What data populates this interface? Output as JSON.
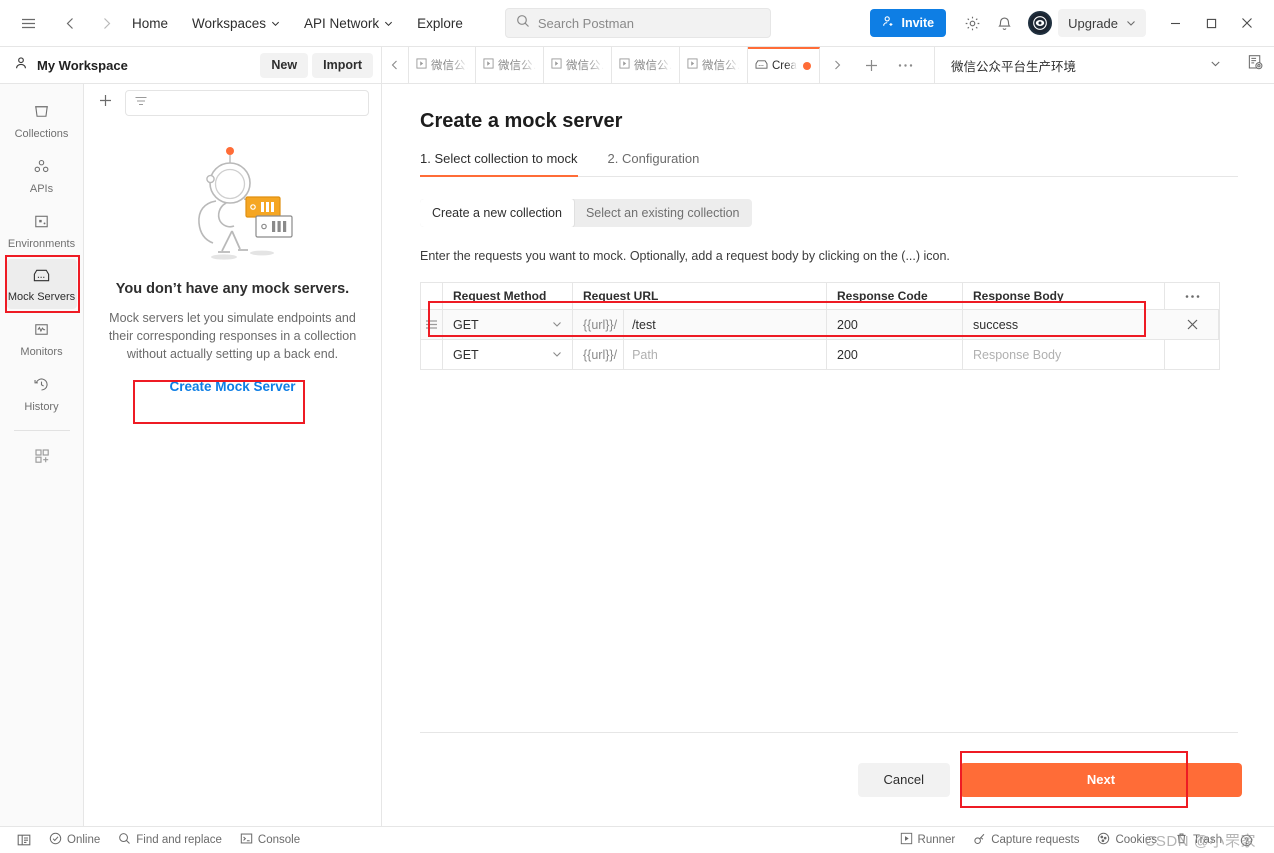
{
  "topbar": {
    "hamburger_icon": "menu-icon",
    "back_icon": "arrow-left-icon",
    "forward_icon": "arrow-right-icon",
    "links": [
      {
        "label": "Home",
        "caret": false
      },
      {
        "label": "Workspaces",
        "caret": true
      },
      {
        "label": "API Network",
        "caret": true
      },
      {
        "label": "Explore",
        "caret": false
      }
    ],
    "search_placeholder": "Search Postman",
    "search_value": "",
    "invite_label": "Invite",
    "settings_icon": "gear-icon",
    "notifications_icon": "bell-icon",
    "avatar_label": "avatar",
    "upgrade_label": "Upgrade",
    "minimize_label": "—",
    "maximize_label": "□",
    "close_label": "✕"
  },
  "workspace": {
    "name": "My Workspace",
    "new_label": "New",
    "import_label": "Import"
  },
  "tabbar": {
    "scroll_left_icon": "chevron-left-icon",
    "scroll_right_icon": "chevron-right-icon",
    "new_tab_icon": "plus-icon",
    "more_icon": "ellipsis-icon",
    "tabs": [
      {
        "label": "微信公…",
        "icon": "request-icon",
        "active": false,
        "unsaved": false
      },
      {
        "label": "微信公…",
        "icon": "request-icon",
        "active": false,
        "unsaved": false
      },
      {
        "label": "微信公…",
        "icon": "request-icon",
        "active": false,
        "unsaved": false
      },
      {
        "label": "微信公…",
        "icon": "request-icon",
        "active": false,
        "unsaved": false
      },
      {
        "label": "微信公…",
        "icon": "request-icon",
        "active": false,
        "unsaved": false
      },
      {
        "label": "Crea",
        "icon": "mock-server-icon",
        "active": true,
        "unsaved": true
      }
    ],
    "environment": "微信公众平台生产环境",
    "env_caret_icon": "chevron-down-icon",
    "env_view_icon": "eye-preview-icon"
  },
  "rail": {
    "items": [
      {
        "label": "Collections",
        "icon": "collections-icon",
        "active": false
      },
      {
        "label": "APIs",
        "icon": "apis-icon",
        "active": false
      },
      {
        "label": "Environments",
        "icon": "environments-icon",
        "active": false
      },
      {
        "label": "Mock Servers",
        "icon": "mock-servers-icon",
        "active": true
      },
      {
        "label": "Monitors",
        "icon": "monitors-icon",
        "active": false
      },
      {
        "label": "History",
        "icon": "history-icon",
        "active": false
      }
    ],
    "add_icon": "grid-plus-icon"
  },
  "sidebar": {
    "add_icon": "plus-icon",
    "filter_icon": "filter-icon",
    "filter_placeholder": "",
    "empty_title": "You don’t have any mock servers.",
    "empty_desc": "Mock servers let you simulate endpoints and their corresponding responses in a collection without actually setting up a back end.",
    "create_link": "Create Mock Server"
  },
  "main": {
    "title": "Create a mock server",
    "steps": [
      {
        "label": "1.  Select collection to mock",
        "active": true
      },
      {
        "label": "2. Configuration",
        "active": false
      }
    ],
    "segmented": [
      {
        "label": "Create a new collection",
        "active": true
      },
      {
        "label": "Select an existing collection",
        "active": false
      }
    ],
    "hint": "Enter the requests you want to mock. Optionally, add a request body by clicking on the (...) icon.",
    "table": {
      "columns": [
        "Request Method",
        "Request URL",
        "Response Code",
        "Response Body"
      ],
      "more_icon": "ellipsis-icon",
      "url_prefix": "{{url}}/",
      "rows": [
        {
          "method": "GET",
          "url": "/test",
          "url_placeholder": "Path",
          "code": "200",
          "body": "success",
          "body_placeholder": "Response Body",
          "filled": true,
          "highlighted": true,
          "delete_icon": "close-icon"
        },
        {
          "method": "GET",
          "url": "",
          "url_placeholder": "Path",
          "code": "200",
          "body": "",
          "body_placeholder": "Response Body",
          "filled": false,
          "highlighted": false,
          "delete_icon": "close-icon"
        }
      ]
    },
    "cancel_label": "Cancel",
    "next_label": "Next"
  },
  "statusbar": {
    "left": [
      {
        "label": "",
        "icon": "sidebar-toggle-icon"
      },
      {
        "label": "Online",
        "icon": "online-icon"
      },
      {
        "label": "Find and replace",
        "icon": "search-icon"
      },
      {
        "label": "Console",
        "icon": "console-icon"
      }
    ],
    "right": [
      {
        "label": "Runner",
        "icon": "runner-icon"
      },
      {
        "label": "Capture requests",
        "icon": "capture-icon"
      },
      {
        "label": "Cookies",
        "icon": "cookies-icon"
      },
      {
        "label": "Trash",
        "icon": "trash-icon"
      },
      {
        "label": "",
        "icon": "help-icon"
      }
    ]
  },
  "annotations": {
    "color": "#ee1b24",
    "boxes": [
      "mock-servers-rail-item",
      "create-mock-server-link",
      "first-request-row",
      "next-button"
    ]
  },
  "watermark": "CSDN @小罘家"
}
